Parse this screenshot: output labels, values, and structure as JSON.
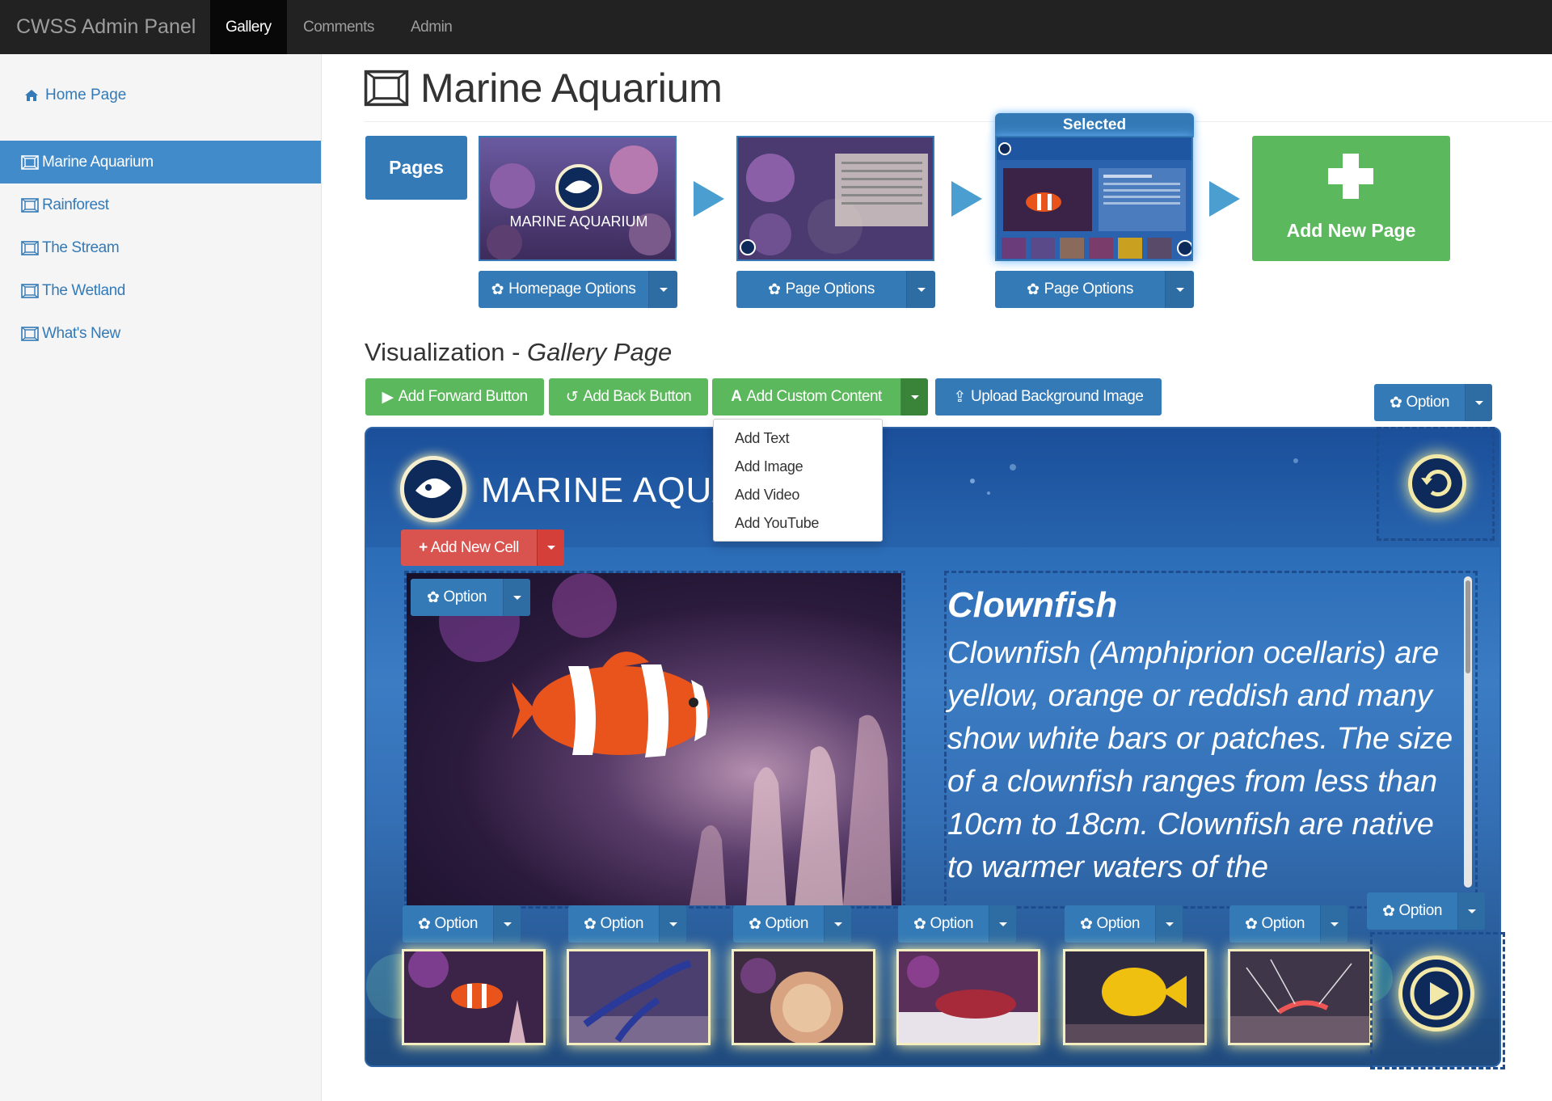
{
  "navbar": {
    "brand": "CWSS Admin Panel",
    "items": [
      {
        "label": "Gallery",
        "active": true
      },
      {
        "label": "Comments",
        "active": false
      },
      {
        "label": "Admin",
        "active": false
      }
    ]
  },
  "sidebar": {
    "home": "Home Page",
    "items": [
      {
        "label": "Marine Aquarium",
        "active": true
      },
      {
        "label": "Rainforest"
      },
      {
        "label": "The Stream"
      },
      {
        "label": "The Wetland"
      },
      {
        "label": "What's New"
      }
    ]
  },
  "page": {
    "title": "Marine Aquarium"
  },
  "pages_strip": {
    "pages_label": "Pages",
    "selected_label": "Selected",
    "add_new_page": "Add New Page",
    "thumb_labels": [
      "MARINE AQUARIUM"
    ],
    "options": [
      "Homepage Options",
      "Page Options",
      "Page Options"
    ]
  },
  "visualization": {
    "prefix": "Visualization - ",
    "page_type": "Gallery Page"
  },
  "toolbar": {
    "add_forward": "Add Forward Button",
    "add_back": "Add Back Button",
    "add_custom": "Add Custom Content",
    "upload_bg": "Upload Background Image",
    "option": "Option"
  },
  "custom_menu": [
    "Add Text",
    "Add Image",
    "Add Video",
    "Add YouTube"
  ],
  "canvas": {
    "logo_text": "MARINE AQUA",
    "add_new_cell": "Add New Cell",
    "option": "Option",
    "text_heading": "Clownfish",
    "text_body": "Clownfish (Amphiprion ocellaris) are yellow, orange or reddish and many show white bars or patches. The size of a clownfish ranges from less than 10cm to 18cm. Clownfish are native to warmer waters of the"
  },
  "colors": {
    "primary": "#337ab7",
    "success": "#5cb85c",
    "danger": "#d9534f",
    "navbar": "#222222",
    "sidebar_active": "#428bca"
  }
}
